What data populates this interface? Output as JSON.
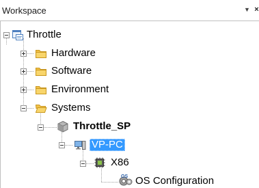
{
  "panel": {
    "title": "Workspace",
    "dropdown_glyph": "▼",
    "close_glyph": "×"
  },
  "tree": {
    "root": {
      "label": "Throttle",
      "icon": "project-icon",
      "expanded": true
    },
    "children": [
      {
        "label": "Hardware",
        "icon": "folder-icon",
        "expanded": false
      },
      {
        "label": "Software",
        "icon": "folder-icon",
        "expanded": false
      },
      {
        "label": "Environment",
        "icon": "folder-icon",
        "expanded": false
      },
      {
        "label": "Systems",
        "icon": "folder-icon",
        "expanded": true
      }
    ],
    "system": {
      "label": "Throttle_SP",
      "icon": "system-cube-icon",
      "expanded": true,
      "bold": true
    },
    "target": {
      "label": "VP-PC",
      "icon": "pc-icon",
      "expanded": true,
      "selected": true
    },
    "processor": {
      "label": "X86",
      "icon": "processor-icon",
      "expanded": true
    },
    "config": {
      "label": "OS Configuration",
      "icon": "os-config-icon"
    }
  },
  "colors": {
    "selection": "#3399ff",
    "folder": "#f2c24a"
  }
}
